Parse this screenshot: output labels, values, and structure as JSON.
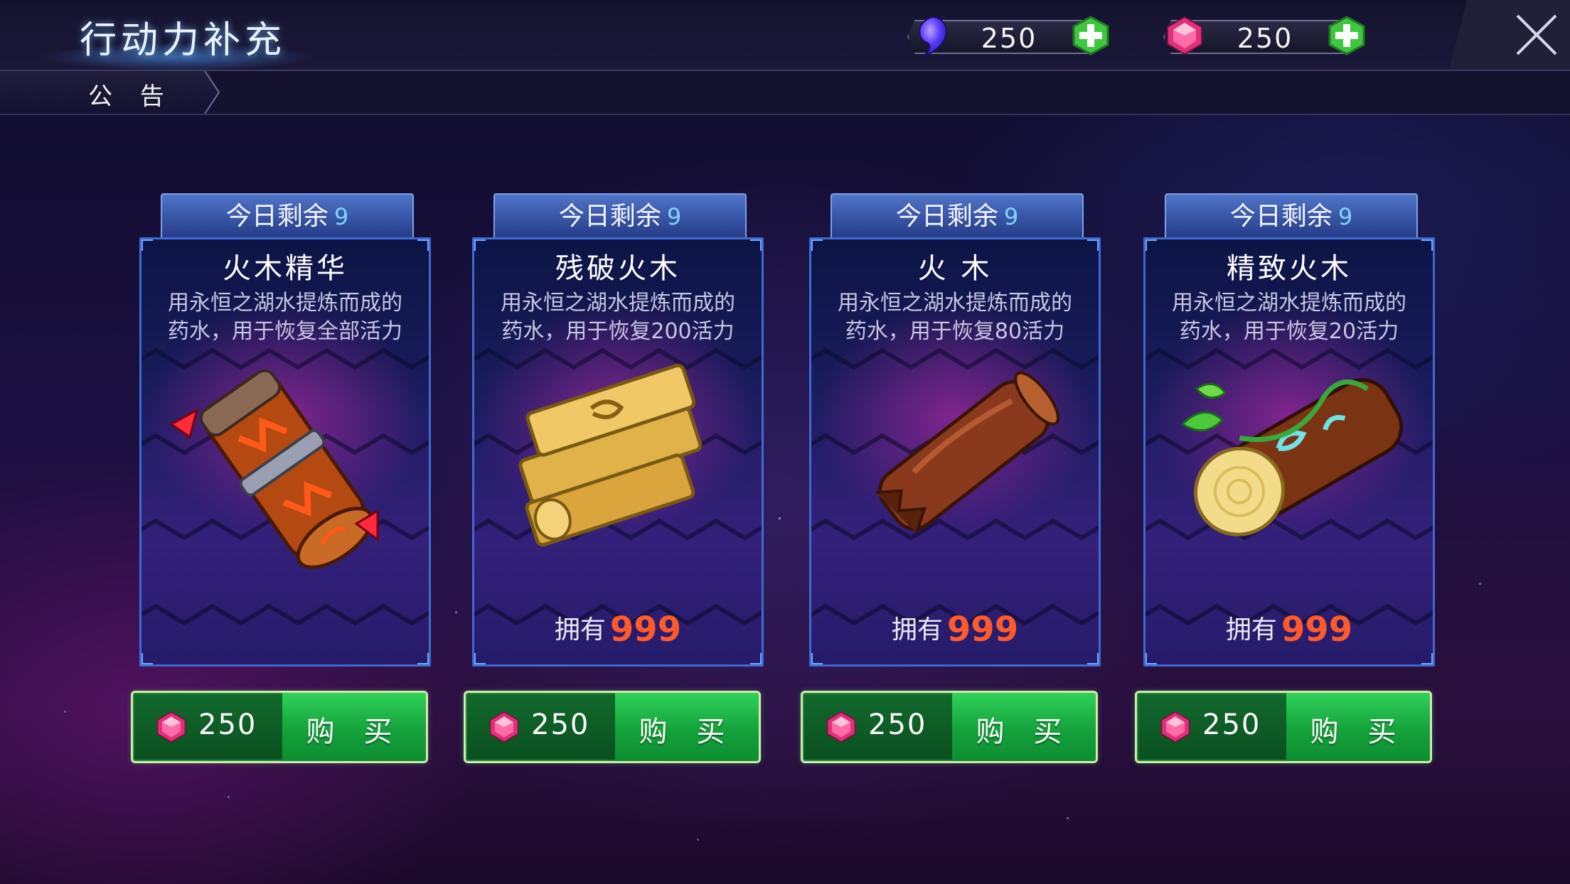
{
  "header": {
    "title": "行动力补充",
    "close_icon": "close-icon",
    "currencies": [
      {
        "icon": "energy-drop-icon",
        "amount": "250",
        "color": "#5a3dff"
      },
      {
        "icon": "gem-icon",
        "amount": "250",
        "color": "#e0307a"
      }
    ]
  },
  "notice": {
    "label": "公 告"
  },
  "cards": [
    {
      "daily_label": "今日剩余",
      "daily_count": "9",
      "name": "火木精华",
      "desc_line1": "用永恒之湖水提炼而成的",
      "desc_line2": "药水，用于恢复全部活力",
      "owned_label": "",
      "owned_count": "",
      "icon": "firewood-essence-icon",
      "price": "250",
      "buy_label": "购 买"
    },
    {
      "daily_label": "今日剩余",
      "daily_count": "9",
      "name": "残破火木",
      "desc_line1": "用永恒之湖水提炼而成的",
      "desc_line2": "药水，用于恢复200活力",
      "owned_label": "拥有",
      "owned_count": "999",
      "icon": "broken-firewood-icon",
      "price": "250",
      "buy_label": "购 买"
    },
    {
      "daily_label": "今日剩余",
      "daily_count": "9",
      "name": "火 木",
      "desc_line1": "用永恒之湖水提炼而成的",
      "desc_line2": "药水，用于恢复80活力",
      "owned_label": "拥有",
      "owned_count": "999",
      "icon": "firewood-icon",
      "price": "250",
      "buy_label": "购 买"
    },
    {
      "daily_label": "今日剩余",
      "daily_count": "9",
      "name": "精致火木",
      "desc_line1": "用永恒之湖水提炼而成的",
      "desc_line2": "药水，用于恢复20活力",
      "owned_label": "拥有",
      "owned_count": "999",
      "icon": "fine-firewood-icon",
      "price": "250",
      "buy_label": "购 买"
    }
  ],
  "colors": {
    "accent_blue": "#3f6ad0",
    "buy_green": "#14a23b",
    "owned_count": "#ff5a2a",
    "plus_green": "#3fc83f"
  }
}
